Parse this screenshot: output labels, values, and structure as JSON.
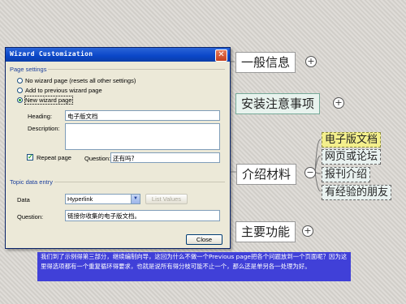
{
  "dialog": {
    "title": "Wizard Customization",
    "close_glyph": "✕",
    "page_settings": {
      "label": "Page settings",
      "options": [
        "No wizard page (resets all other settings)",
        "Add to previous wizard page",
        "New wizard page"
      ],
      "selected_index": 2,
      "heading_label": "Heading:",
      "heading_value": "电子版文档",
      "description_label": "Description:",
      "description_value": "",
      "repeat_label": "Repeat page",
      "repeat_checked": true,
      "question_label": "Question:",
      "question_value": "还有吗?"
    },
    "topic_entry": {
      "label": "Topic data entry",
      "data_label": "Data",
      "data_value": "Hyperlink",
      "list_values_label": "List Values",
      "question_label": "Question:",
      "question_value": "链接你收集的电子版文档。"
    },
    "close_button_label": "Close"
  },
  "mindmap": {
    "nodes": [
      {
        "label": "一般信息",
        "expander": "+"
      },
      {
        "label": "安装注意事项",
        "expander": "+"
      },
      {
        "label": "介绍材料",
        "expander": "−"
      },
      {
        "label": "主要功能",
        "expander": "+"
      }
    ],
    "subnodes": [
      "电子版文档",
      "网页或论坛",
      "报刊介绍",
      "有经验的朋友"
    ],
    "highlighted_subnode": 0
  },
  "caption": {
    "text": "我们到了示例得第三部分，继续编制向导，这回为什么不做一个Previous page把各个问题放到一个页面呢？因为这里得选项都有一个重复循环得要求，也就是说所有得分枝可能不止一个，那么还是单另各一处理为好。"
  },
  "colors": {
    "titlebar": "#0a46c8",
    "caption_bg": "#4040d8",
    "highlight": "#f3ef8c",
    "section_label": "#1b3f9c"
  }
}
